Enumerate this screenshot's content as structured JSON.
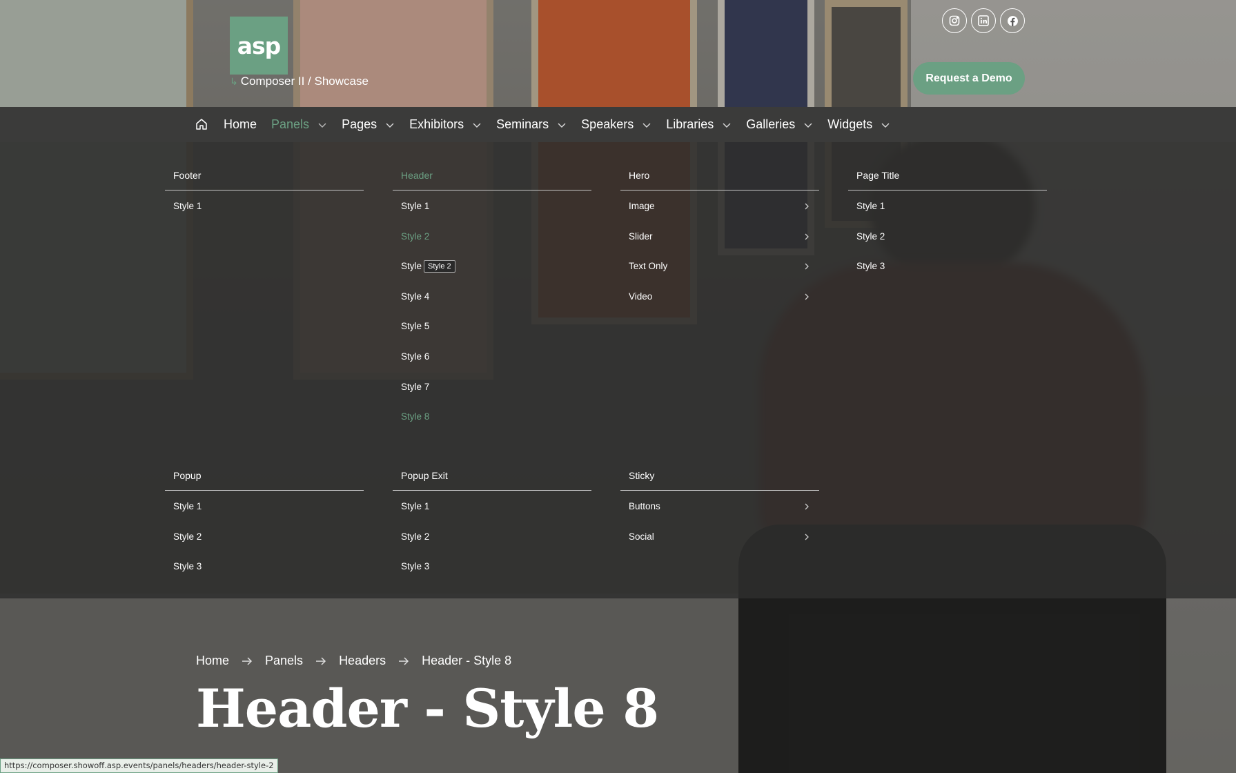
{
  "colors": {
    "accent": "#6ba083",
    "nav_bg": "#3b3b3a"
  },
  "brand": {
    "logo_text": "asp",
    "site_path": "Composer II / Showcase"
  },
  "social_icons": [
    "instagram-icon",
    "linkedin-icon",
    "facebook-icon"
  ],
  "demo_button": "Request a Demo",
  "nav": {
    "home_icon": "home-icon",
    "items": [
      {
        "label": "Home",
        "has_dropdown": false
      },
      {
        "label": "Panels",
        "has_dropdown": true,
        "active": true
      },
      {
        "label": "Pages",
        "has_dropdown": true
      },
      {
        "label": "Exhibitors",
        "has_dropdown": true
      },
      {
        "label": "Seminars",
        "has_dropdown": true
      },
      {
        "label": "Speakers",
        "has_dropdown": true
      },
      {
        "label": "Libraries",
        "has_dropdown": true
      },
      {
        "label": "Galleries",
        "has_dropdown": true
      },
      {
        "label": "Widgets",
        "has_dropdown": true
      }
    ]
  },
  "mega_menu": {
    "columns": [
      {
        "title": "Footer",
        "items": [
          {
            "label": "Style 1"
          }
        ]
      },
      {
        "title": "Header",
        "active": true,
        "items": [
          {
            "label": "Style 1"
          },
          {
            "label": "Style 2",
            "active": true
          },
          {
            "label": "Style 3"
          },
          {
            "label": "Style 4"
          },
          {
            "label": "Style 5"
          },
          {
            "label": "Style 6"
          },
          {
            "label": "Style 7"
          },
          {
            "label": "Style 8",
            "active": true
          }
        ]
      },
      {
        "title": "Hero",
        "items": [
          {
            "label": "Image",
            "submenu": true
          },
          {
            "label": "Slider",
            "submenu": true
          },
          {
            "label": "Text Only",
            "submenu": true
          },
          {
            "label": "Video",
            "submenu": true
          }
        ]
      },
      {
        "title": "Page Title",
        "items": [
          {
            "label": "Style 1"
          },
          {
            "label": "Style 2"
          },
          {
            "label": "Style 3"
          }
        ]
      },
      {
        "title": "Popup",
        "items": [
          {
            "label": "Style 1"
          },
          {
            "label": "Style 2"
          },
          {
            "label": "Style 3"
          }
        ]
      },
      {
        "title": "Popup Exit",
        "items": [
          {
            "label": "Style 1"
          },
          {
            "label": "Style 2"
          },
          {
            "label": "Style 3"
          }
        ]
      },
      {
        "title": "Sticky",
        "items": [
          {
            "label": "Buttons",
            "submenu": true
          },
          {
            "label": "Social",
            "submenu": true
          }
        ]
      }
    ],
    "tooltip": "Style 2"
  },
  "breadcrumb": [
    "Home",
    "Panels",
    "Headers",
    "Header - Style 8"
  ],
  "page_title": "Header - Style 8",
  "status_url": "https://composer.showoff.asp.events/panels/headers/header-style-2"
}
